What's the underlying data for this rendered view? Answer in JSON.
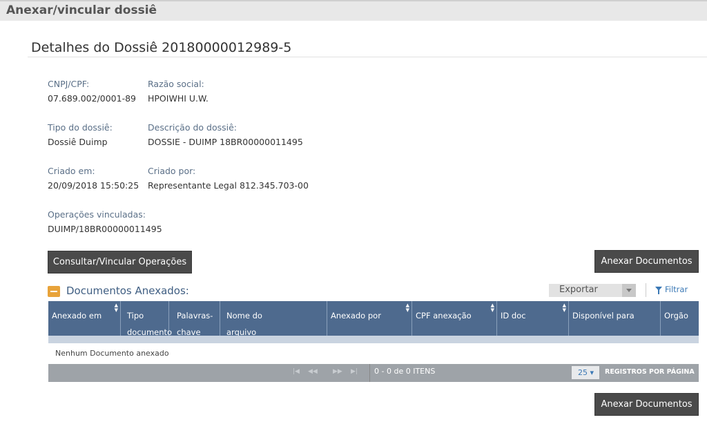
{
  "window": {
    "title": "Anexar/vincular dossiê"
  },
  "dossie": {
    "heading": "Detalhes do Dossiê 20180000012989-5",
    "fields": {
      "cnpj_label": "CNPJ/CPF:",
      "cnpj_value": "07.689.002/0001-89",
      "razao_label": "Razão social:",
      "razao_value": "HPOIWHI U.W.",
      "tipo_label": "Tipo do dossiê:",
      "tipo_value": "Dossiê Duimp",
      "descricao_label": "Descrição do dossiê:",
      "descricao_value": "DOSSIE - DUIMP 18BR00000011495",
      "criado_em_label": "Criado em:",
      "criado_em_value": "20/09/2018 15:50:25",
      "criado_por_label": "Criado por:",
      "criado_por_value": "Representante Legal 812.345.703-00",
      "operacoes_label": "Operações vinculadas:",
      "operacoes_value": "DUIMP/18BR00000011495"
    }
  },
  "buttons": {
    "consultar": "Consultar/Vincular Operações",
    "anexar": "Anexar Documentos"
  },
  "documentos": {
    "title": "Documentos Anexados:",
    "exportar": "Exportar",
    "filtrar": "Filtrar",
    "columns": {
      "anexado_em": "Anexado em",
      "tipo_documento_1": "Tipo",
      "tipo_documento_2": "documento",
      "palavras_chave_1": "Palavras-",
      "palavras_chave_2": "chave",
      "nome_arquivo_1": "Nome do",
      "nome_arquivo_2": "arquivo",
      "anexado_por": "Anexado por",
      "cpf_anexacao": "CPF anexação",
      "id_doc": "ID doc",
      "disponivel_para": "Disponível para",
      "orgao": "Orgão"
    },
    "empty_message": "Nenhum Documento anexado",
    "pager": {
      "info": "0 - 0 de 0 ITENS",
      "page_size": "25",
      "page_size_label": "REGISTROS POR PÁGINA"
    }
  },
  "colors": {
    "grid_header": "#4e6a8e",
    "accent_orange": "#e8a33a",
    "dark_button": "#4a4a4a",
    "link_blue": "#3a78b5"
  }
}
